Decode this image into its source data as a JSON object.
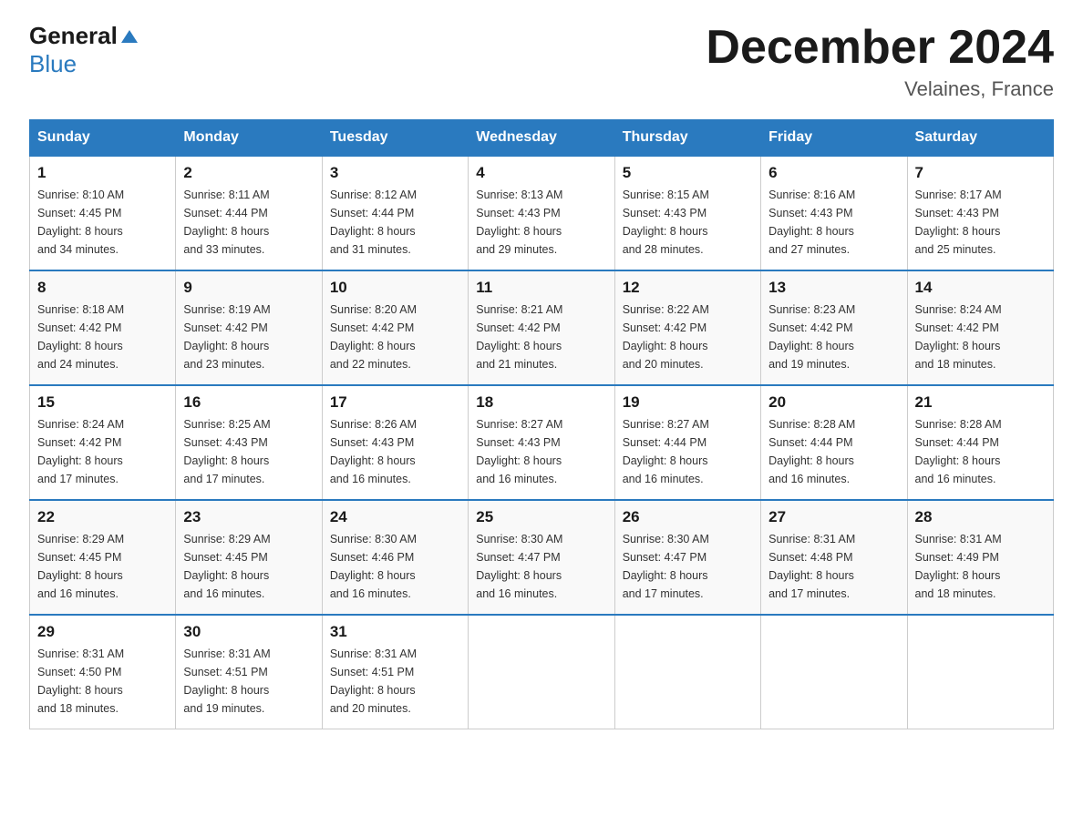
{
  "header": {
    "logo_general": "General",
    "logo_blue": "Blue",
    "month_title": "December 2024",
    "location": "Velaines, France"
  },
  "days_of_week": [
    "Sunday",
    "Monday",
    "Tuesday",
    "Wednesday",
    "Thursday",
    "Friday",
    "Saturday"
  ],
  "weeks": [
    [
      {
        "day": "1",
        "sunrise": "8:10 AM",
        "sunset": "4:45 PM",
        "daylight": "8 hours and 34 minutes."
      },
      {
        "day": "2",
        "sunrise": "8:11 AM",
        "sunset": "4:44 PM",
        "daylight": "8 hours and 33 minutes."
      },
      {
        "day": "3",
        "sunrise": "8:12 AM",
        "sunset": "4:44 PM",
        "daylight": "8 hours and 31 minutes."
      },
      {
        "day": "4",
        "sunrise": "8:13 AM",
        "sunset": "4:43 PM",
        "daylight": "8 hours and 29 minutes."
      },
      {
        "day": "5",
        "sunrise": "8:15 AM",
        "sunset": "4:43 PM",
        "daylight": "8 hours and 28 minutes."
      },
      {
        "day": "6",
        "sunrise": "8:16 AM",
        "sunset": "4:43 PM",
        "daylight": "8 hours and 27 minutes."
      },
      {
        "day": "7",
        "sunrise": "8:17 AM",
        "sunset": "4:43 PM",
        "daylight": "8 hours and 25 minutes."
      }
    ],
    [
      {
        "day": "8",
        "sunrise": "8:18 AM",
        "sunset": "4:42 PM",
        "daylight": "8 hours and 24 minutes."
      },
      {
        "day": "9",
        "sunrise": "8:19 AM",
        "sunset": "4:42 PM",
        "daylight": "8 hours and 23 minutes."
      },
      {
        "day": "10",
        "sunrise": "8:20 AM",
        "sunset": "4:42 PM",
        "daylight": "8 hours and 22 minutes."
      },
      {
        "day": "11",
        "sunrise": "8:21 AM",
        "sunset": "4:42 PM",
        "daylight": "8 hours and 21 minutes."
      },
      {
        "day": "12",
        "sunrise": "8:22 AM",
        "sunset": "4:42 PM",
        "daylight": "8 hours and 20 minutes."
      },
      {
        "day": "13",
        "sunrise": "8:23 AM",
        "sunset": "4:42 PM",
        "daylight": "8 hours and 19 minutes."
      },
      {
        "day": "14",
        "sunrise": "8:24 AM",
        "sunset": "4:42 PM",
        "daylight": "8 hours and 18 minutes."
      }
    ],
    [
      {
        "day": "15",
        "sunrise": "8:24 AM",
        "sunset": "4:42 PM",
        "daylight": "8 hours and 17 minutes."
      },
      {
        "day": "16",
        "sunrise": "8:25 AM",
        "sunset": "4:43 PM",
        "daylight": "8 hours and 17 minutes."
      },
      {
        "day": "17",
        "sunrise": "8:26 AM",
        "sunset": "4:43 PM",
        "daylight": "8 hours and 16 minutes."
      },
      {
        "day": "18",
        "sunrise": "8:27 AM",
        "sunset": "4:43 PM",
        "daylight": "8 hours and 16 minutes."
      },
      {
        "day": "19",
        "sunrise": "8:27 AM",
        "sunset": "4:44 PM",
        "daylight": "8 hours and 16 minutes."
      },
      {
        "day": "20",
        "sunrise": "8:28 AM",
        "sunset": "4:44 PM",
        "daylight": "8 hours and 16 minutes."
      },
      {
        "day": "21",
        "sunrise": "8:28 AM",
        "sunset": "4:44 PM",
        "daylight": "8 hours and 16 minutes."
      }
    ],
    [
      {
        "day": "22",
        "sunrise": "8:29 AM",
        "sunset": "4:45 PM",
        "daylight": "8 hours and 16 minutes."
      },
      {
        "day": "23",
        "sunrise": "8:29 AM",
        "sunset": "4:45 PM",
        "daylight": "8 hours and 16 minutes."
      },
      {
        "day": "24",
        "sunrise": "8:30 AM",
        "sunset": "4:46 PM",
        "daylight": "8 hours and 16 minutes."
      },
      {
        "day": "25",
        "sunrise": "8:30 AM",
        "sunset": "4:47 PM",
        "daylight": "8 hours and 16 minutes."
      },
      {
        "day": "26",
        "sunrise": "8:30 AM",
        "sunset": "4:47 PM",
        "daylight": "8 hours and 17 minutes."
      },
      {
        "day": "27",
        "sunrise": "8:31 AM",
        "sunset": "4:48 PM",
        "daylight": "8 hours and 17 minutes."
      },
      {
        "day": "28",
        "sunrise": "8:31 AM",
        "sunset": "4:49 PM",
        "daylight": "8 hours and 18 minutes."
      }
    ],
    [
      {
        "day": "29",
        "sunrise": "8:31 AM",
        "sunset": "4:50 PM",
        "daylight": "8 hours and 18 minutes."
      },
      {
        "day": "30",
        "sunrise": "8:31 AM",
        "sunset": "4:51 PM",
        "daylight": "8 hours and 19 minutes."
      },
      {
        "day": "31",
        "sunrise": "8:31 AM",
        "sunset": "4:51 PM",
        "daylight": "8 hours and 20 minutes."
      },
      null,
      null,
      null,
      null
    ]
  ],
  "labels": {
    "sunrise_prefix": "Sunrise: ",
    "sunset_prefix": "Sunset: ",
    "daylight_prefix": "Daylight: "
  }
}
